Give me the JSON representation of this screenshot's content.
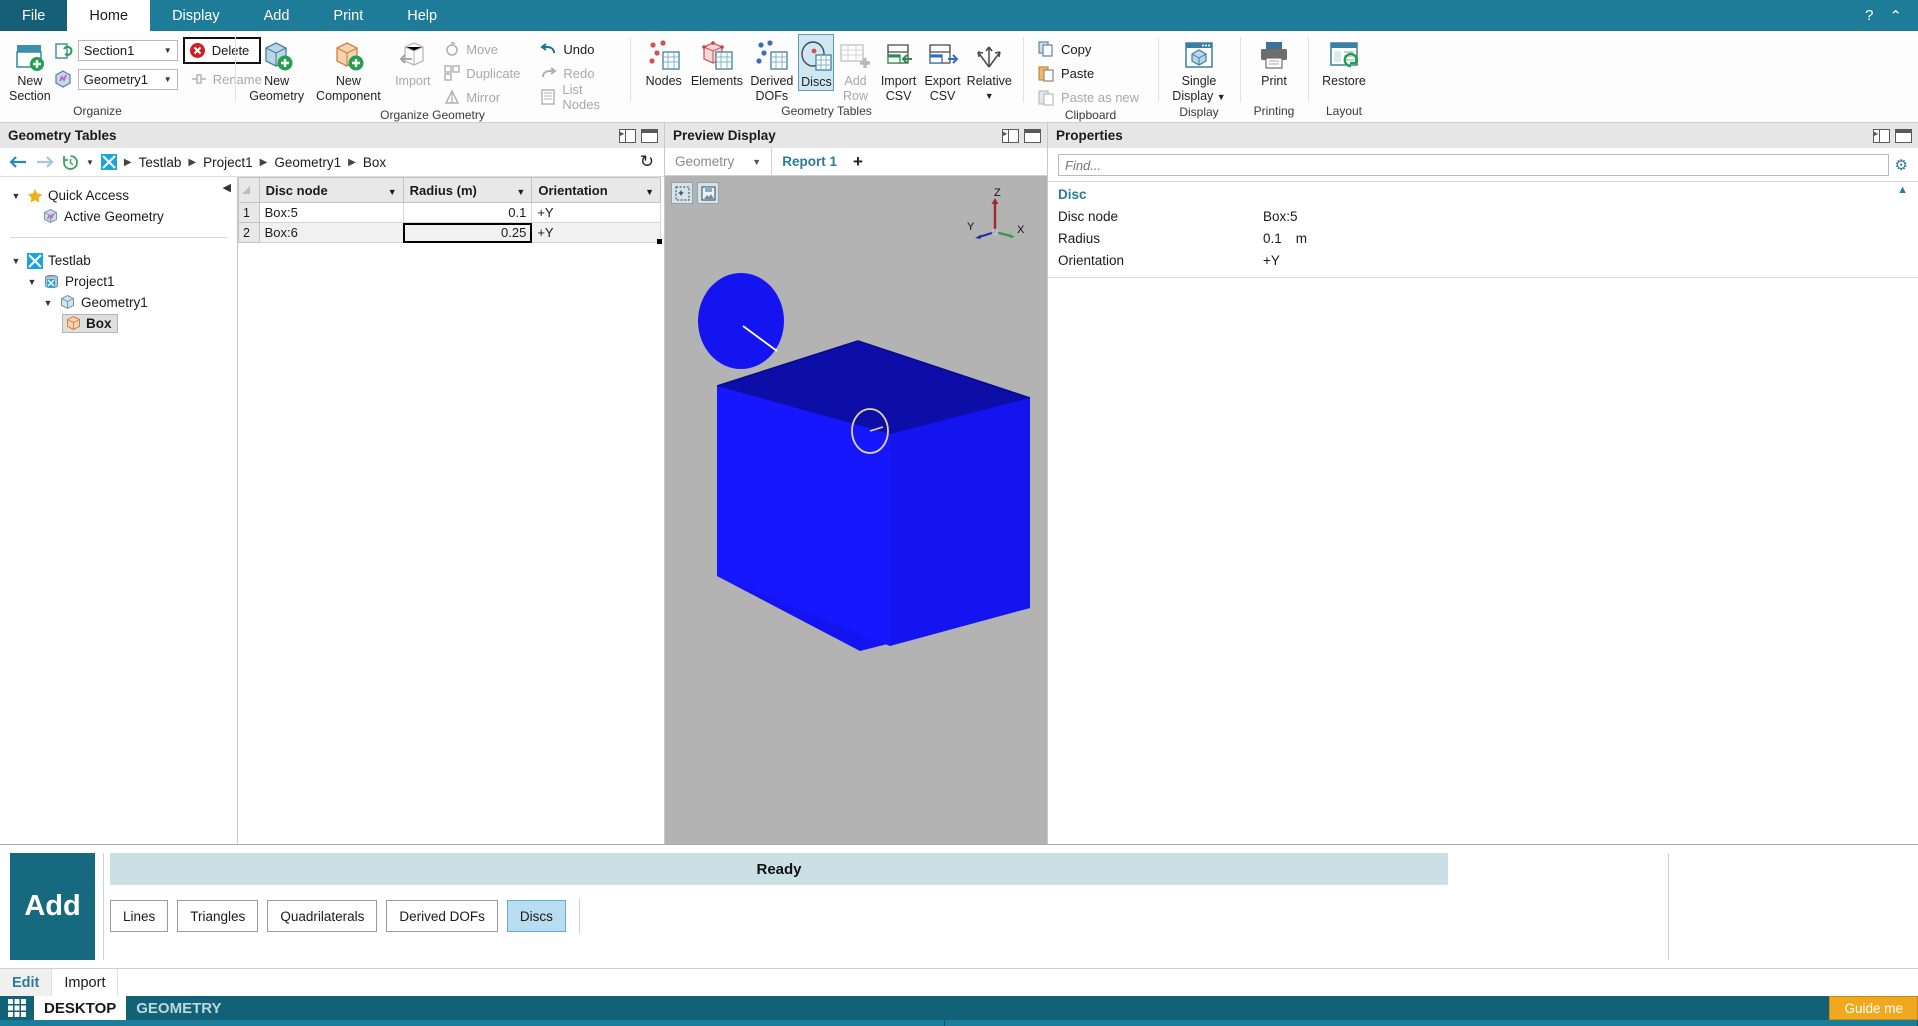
{
  "menubar": {
    "items": [
      {
        "label": "File",
        "state": "file"
      },
      {
        "label": "Home",
        "state": "active"
      },
      {
        "label": "Display",
        "state": "normal"
      },
      {
        "label": "Add",
        "state": "normal"
      },
      {
        "label": "Print",
        "state": "normal"
      },
      {
        "label": "Help",
        "state": "normal"
      }
    ],
    "help_glyph": "?",
    "collapse_glyph": "⌃"
  },
  "ribbon": {
    "groups": [
      {
        "title": "Organize",
        "new_section_label": "New\nSection",
        "new_section_line1": "New",
        "new_section_line2": "Section",
        "combo_section": "Section1",
        "combo_geometry": "Geometry1",
        "delete_label": "Delete",
        "rename_label": "Rename"
      },
      {
        "title": "Organize Geometry",
        "new_geometry_line1": "New",
        "new_geometry_line2": "Geometry",
        "new_component_line1": "New",
        "new_component_line2": "Component",
        "import_label": "Import",
        "move_label": "Move",
        "duplicate_label": "Duplicate",
        "mirror_label": "Mirror",
        "undo_label": "Undo",
        "redo_label": "Redo",
        "list_nodes_label": "List Nodes"
      },
      {
        "title": "Geometry Tables",
        "nodes_label": "Nodes",
        "elements_label": "Elements",
        "derived_dofs_line1": "Derived",
        "derived_dofs_line2": "DOFs",
        "discs_label": "Discs",
        "add_row_line1": "Add",
        "add_row_line2": "Row",
        "import_csv_line1": "Import",
        "import_csv_line2": "CSV",
        "export_csv_line1": "Export",
        "export_csv_line2": "CSV",
        "relative_label": "Relative"
      },
      {
        "title": "Clipboard",
        "copy_label": "Copy",
        "paste_label": "Paste",
        "paste_as_new_label": "Paste as new"
      },
      {
        "title": "Display",
        "single_display_line1": "Single",
        "single_display_line2": "Display"
      },
      {
        "title": "Printing",
        "print_label": "Print"
      },
      {
        "title": "Layout",
        "restore_label": "Restore"
      }
    ]
  },
  "left_panel": {
    "header": "Geometry Tables",
    "breadcrumb": [
      "Testlab",
      "Project1",
      "Geometry1",
      "Box"
    ],
    "tree": {
      "quick_access_label": "Quick Access",
      "active_geometry_label": "Active Geometry",
      "root_label": "Testlab",
      "project_label": "Project1",
      "geometry_label": "Geometry1",
      "box_label": "Box"
    },
    "table": {
      "columns": [
        "Disc node",
        "Radius (m)",
        "Orientation"
      ],
      "rows": [
        {
          "index": "1",
          "disc_node": "Box:5",
          "radius": "0.1",
          "orientation": "+Y"
        },
        {
          "index": "2",
          "disc_node": "Box:6",
          "radius": "0.25",
          "orientation": "+Y"
        }
      ]
    }
  },
  "center_panel": {
    "header": "Preview Display",
    "tab_geometry": "Geometry",
    "tab_report": "Report 1",
    "tab_add": "+",
    "axis_labels": {
      "x": "X",
      "y": "Y",
      "z": "Z"
    }
  },
  "right_panel": {
    "header": "Properties",
    "find_placeholder": "Find...",
    "group_title": "Disc",
    "rows": [
      {
        "label": "Disc node",
        "value": "Box:5",
        "unit": ""
      },
      {
        "label": "Radius",
        "value": "0.1",
        "unit": "m"
      },
      {
        "label": "Orientation",
        "value": "+Y",
        "unit": ""
      }
    ]
  },
  "bottom_dock": {
    "add_label": "Add",
    "status": "Ready",
    "chips": [
      {
        "label": "Lines",
        "selected": false
      },
      {
        "label": "Triangles",
        "selected": false
      },
      {
        "label": "Quadrilaterals",
        "selected": false
      },
      {
        "label": "Derived DOFs",
        "selected": false
      },
      {
        "label": "Discs",
        "selected": true
      }
    ],
    "foot_tabs": [
      {
        "label": "Edit",
        "active": true
      },
      {
        "label": "Import",
        "active": false
      }
    ]
  },
  "taskbar": {
    "desktop_label": "DESKTOP",
    "geometry_label": "GEOMETRY",
    "guide_me_label": "Guide me"
  },
  "colors": {
    "accent": "#1f7c98",
    "teal_dark": "#126177",
    "selection_blue": "#bfdfe8",
    "geometry_blue": "#1414f0",
    "guide_orange": "#f0a81e"
  }
}
